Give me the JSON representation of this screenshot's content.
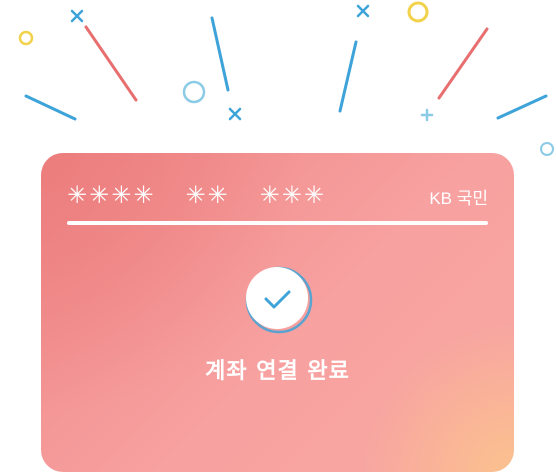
{
  "card": {
    "masked_number_groups": [
      "✳✳✳✳",
      "✳✳",
      "✳✳✳"
    ],
    "bank_name": "KB 국민",
    "status_text": "계좌 연결 완료",
    "status_icon": "check-circle-icon"
  },
  "colors": {
    "card_base": "#f7a1a0",
    "card_warm_corner": "#fac48c",
    "confetti_blue": "#3ea3d8",
    "confetti_red": "#e86f6f",
    "confetti_yellow": "#f2d24a",
    "confetti_light_blue": "#8ccbe6",
    "check_stroke": "#3ea3d8"
  }
}
